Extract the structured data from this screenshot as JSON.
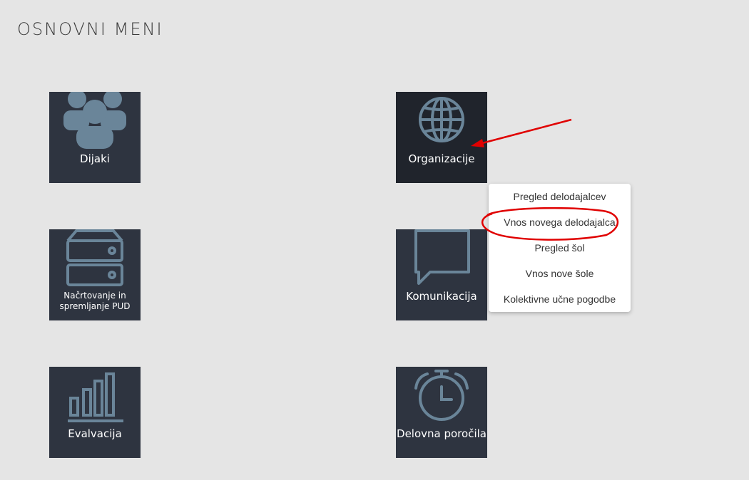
{
  "page": {
    "title": "OSNOVNI MENI"
  },
  "tiles": [
    {
      "label": "Dijaki",
      "icon": "students-group-icon"
    },
    {
      "label": "Organizacije",
      "icon": "globe-icon"
    },
    {
      "label": "Načrtovanje in spremljanje PUD",
      "icon": "server-stack-icon"
    },
    {
      "label": "Komunikacija",
      "icon": "speech-bubble-icon"
    },
    {
      "label": "Evalvacija",
      "icon": "bar-chart-icon"
    },
    {
      "label": "Delovna poročila",
      "icon": "alarm-clock-icon"
    }
  ],
  "dropdown": {
    "items": [
      {
        "label": "Pregled delodajalcev"
      },
      {
        "label": "Vnos novega delodajalca"
      },
      {
        "label": "Pregled šol"
      },
      {
        "label": "Vnos nove šole"
      },
      {
        "label": "Kolektivne učne pogodbe"
      }
    ]
  },
  "colors": {
    "background": "#e5e5e5",
    "tile": "#2e3440",
    "tile_active": "#20242c",
    "icon": "#6a8599",
    "annotation": "#e00000"
  }
}
